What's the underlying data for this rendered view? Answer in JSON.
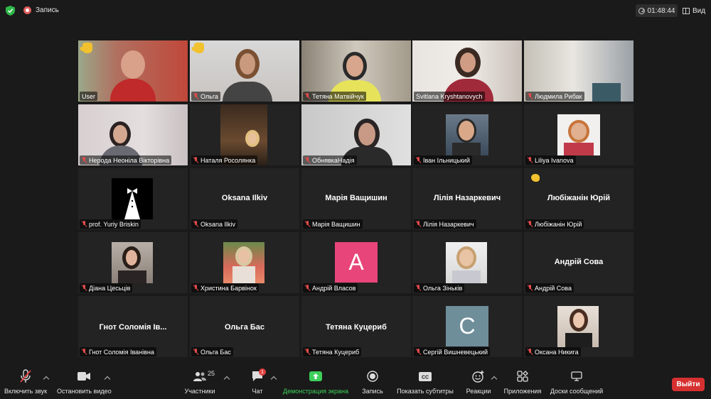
{
  "topbar": {
    "record_label": "Запись",
    "timer": "01:48:44",
    "view_label": "Вид"
  },
  "participants": [
    {
      "name": "User",
      "muted": false,
      "hand": true,
      "active": true
    },
    {
      "name": "Ольга",
      "muted": true,
      "hand": true
    },
    {
      "name": "Тетяна Матвійчук",
      "muted": true
    },
    {
      "name": "Svitlana Kryshtanovych",
      "muted": false
    },
    {
      "name": "Людмила Рибак",
      "muted": true
    },
    {
      "name": "Нерода Неоніла Вікторівна",
      "muted": true
    },
    {
      "name": "Наталя Росолянка",
      "muted": true
    },
    {
      "name": "ОбнявкаНадія",
      "muted": true
    },
    {
      "name": "Іван Ільницький",
      "muted": true
    },
    {
      "name": "Liliya Ivanova",
      "muted": true
    },
    {
      "name": "prof. Yuriy Briskin",
      "muted": true
    },
    {
      "name": "Oksana Ilkiv",
      "muted": true,
      "center": "Oksana Ilkiv"
    },
    {
      "name": "Марія Ващишин",
      "muted": false,
      "center": "Марія Ващишин"
    },
    {
      "name": "Лілія Назаркевич",
      "muted": false,
      "center": "Лілія Назаркевич"
    },
    {
      "name": "Любіжанін Юрій",
      "muted": true,
      "center": "Любіжанін Юрій",
      "reaction": true
    },
    {
      "name": "Діана Цесьців",
      "muted": true
    },
    {
      "name": "Христина Барвінок",
      "muted": true
    },
    {
      "name": "Андрій Власов",
      "muted": true,
      "letter": "A",
      "letter_color": "#e8457a"
    },
    {
      "name": "Ольга Зіньків",
      "muted": true
    },
    {
      "name": "Андрій Сова",
      "muted": true,
      "center": "Андрій Сова"
    },
    {
      "name": "Гнот Соломія Іванівна",
      "muted": true,
      "center": "Гнот  Соломія Ів..."
    },
    {
      "name": "Ольга Бас",
      "muted": true,
      "center": "Ольга Бас"
    },
    {
      "name": "Тетяна Куцериб",
      "muted": true,
      "center": "Тетяна Куцериб"
    },
    {
      "name": "Сергій Вишневецький",
      "muted": true,
      "letter": "C",
      "letter_color": "#6e8e9a"
    },
    {
      "name": "Оксана Никига",
      "muted": true
    }
  ],
  "toolbar": {
    "unmute": "Включить звук",
    "stop_video": "Остановить видео",
    "participants": "Участники",
    "participants_count": "25",
    "chat": "Чат",
    "chat_badge": "1",
    "share": "Демонстрация экрана",
    "record": "Запись",
    "subtitles": "Показать субтитры",
    "reactions": "Реакции",
    "apps": "Приложения",
    "whiteboards": "Доски сообщений",
    "leave": "Выйти"
  },
  "colors": {
    "accent_green": "#3ecf5a",
    "leave_red": "#d63030",
    "active_outline": "#c9d83a"
  }
}
